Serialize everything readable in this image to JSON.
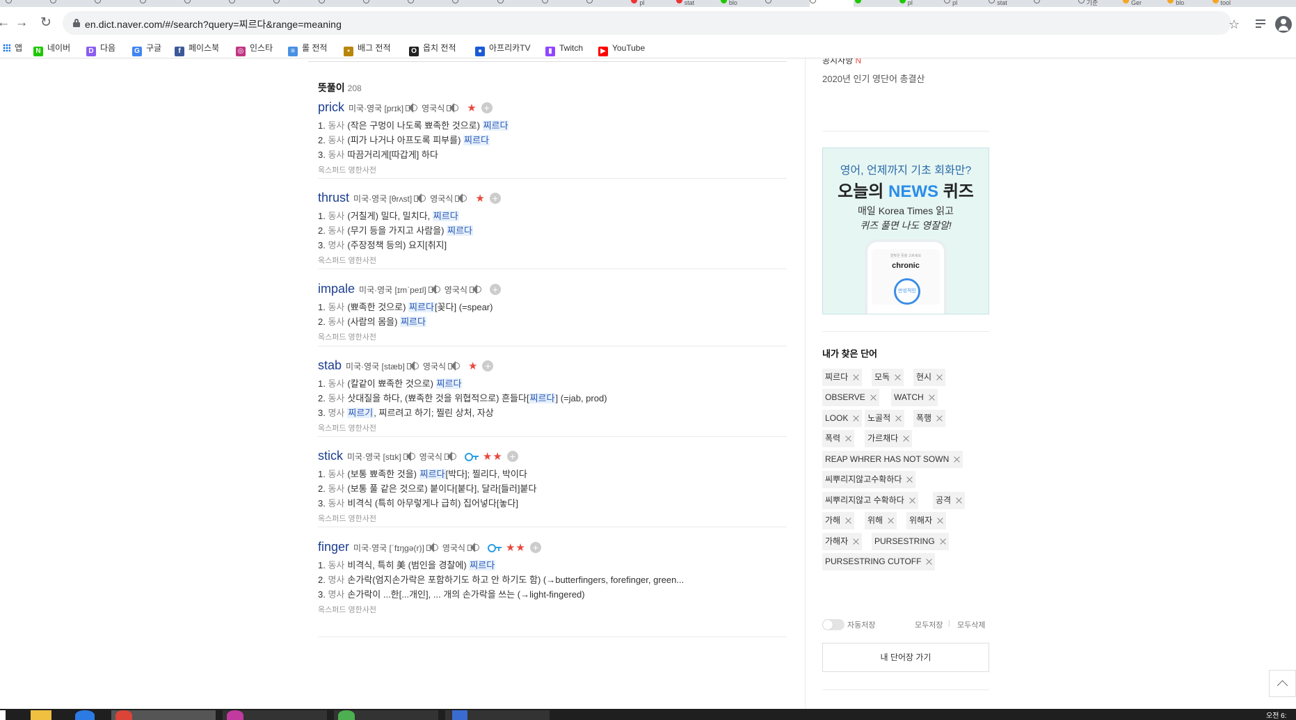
{
  "browser": {
    "url": "en.dict.naver.com/#/search?query=찌르다&range=meaning",
    "tabs": [
      "",
      "",
      "",
      "",
      "",
      "",
      "",
      "",
      "",
      "",
      "",
      "",
      "",
      "",
      "pl",
      "stat",
      "blo",
      "",
      "",
      "",
      "pl",
      "pl",
      "stat",
      "",
      "기준",
      "Ger",
      "blo",
      "tool"
    ]
  },
  "bookmarks": [
    {
      "label": "앱",
      "icon": "apps-grid-icon",
      "color": "#1a73e8"
    },
    {
      "label": "네이버",
      "icon": "naver-n-icon",
      "color": "#1ec800"
    },
    {
      "label": "다음",
      "icon": "daum-d-icon",
      "color": "#8a5cf0"
    },
    {
      "label": "구글",
      "icon": "google-g-icon",
      "color": "#4285f4"
    },
    {
      "label": "페이스북",
      "icon": "facebook-f-icon",
      "color": "#3b5998"
    },
    {
      "label": "인스타",
      "icon": "instagram-icon",
      "color": "#c13584"
    },
    {
      "label": "롤 전적",
      "icon": "opgg-icon",
      "color": "#4a90e2"
    },
    {
      "label": "배그 전적",
      "icon": "pubg-icon",
      "color": "#b8860b"
    },
    {
      "label": "옵치 전적",
      "icon": "overbuff-icon",
      "color": "#222222"
    },
    {
      "label": "아프리카TV",
      "icon": "afreecatv-icon",
      "color": "#1c5bd6"
    },
    {
      "label": "Twitch",
      "icon": "twitch-icon",
      "color": "#9146ff"
    },
    {
      "label": "YouTube",
      "icon": "youtube-icon",
      "color": "#ff0000"
    }
  ],
  "results": {
    "section_title": "뜻풀이",
    "count": "208",
    "entries": [
      {
        "word": "prick",
        "pron_us": "미국·영국 [prɪk]",
        "pron_uk": "영국식",
        "stars": "★",
        "key": false,
        "meanings": [
          {
            "num": "1.",
            "pos": "동사",
            "pre": "(작은 구멍이 나도록 뾰족한 것으로) ",
            "hl": "찌르다",
            "post": ""
          },
          {
            "num": "2.",
            "pos": "동사",
            "pre": "(피가 나거나 아프도록 피부를) ",
            "hl": "찌르다",
            "post": ""
          },
          {
            "num": "3.",
            "pos": "동사",
            "pre": "따끔거리게[따갑게] 하다",
            "hl": "",
            "post": ""
          }
        ],
        "source": "옥스퍼드 영한사전"
      },
      {
        "word": "thrust",
        "pron_us": "미국·영국 [θrʌst]",
        "pron_uk": "영국식",
        "stars": "★",
        "key": false,
        "meanings": [
          {
            "num": "1.",
            "pos": "동사",
            "pre": "(거칠게) 밀다, 밀치다, ",
            "hl": "찌르다",
            "post": ""
          },
          {
            "num": "2.",
            "pos": "동사",
            "pre": "(무기 등을 가지고 사람을) ",
            "hl": "찌르다",
            "post": ""
          },
          {
            "num": "3.",
            "pos": "명사",
            "pre": "(주장정책 등의) 요지[취지]",
            "hl": "",
            "post": ""
          }
        ],
        "source": "옥스퍼드 영한사전"
      },
      {
        "word": "impale",
        "pron_us": "미국·영국 [ɪmˈpeɪl]",
        "pron_uk": "영국식",
        "stars": "",
        "key": false,
        "meanings": [
          {
            "num": "1.",
            "pos": "동사",
            "pre": "(뾰족한 것으로) ",
            "hl": "찌르다",
            "post": "[꽂다] (=spear)"
          },
          {
            "num": "2.",
            "pos": "동사",
            "pre": "(사람의 몸을) ",
            "hl": "찌르다",
            "post": ""
          }
        ],
        "source": "옥스퍼드 영한사전"
      },
      {
        "word": "stab",
        "pron_us": "미국·영국 [stæb]",
        "pron_uk": "영국식",
        "stars": "★",
        "key": false,
        "meanings": [
          {
            "num": "1.",
            "pos": "동사",
            "pre": "(칼같이 뾰족한 것으로) ",
            "hl": "찌르다",
            "post": ""
          },
          {
            "num": "2.",
            "pos": "동사",
            "pre": "삿대질을 하다, (뾰족한 것을 위협적으로) 흔들다[",
            "hl": "찌르다",
            "post": "] (=jab, prod)"
          },
          {
            "num": "3.",
            "pos": "명사",
            "pre": "",
            "hl": "찌르기",
            "post": ", 찌르려고 하기; 찔린 상처, 자상"
          }
        ],
        "source": "옥스퍼드 영한사전"
      },
      {
        "word": "stick",
        "pron_us": "미국·영국 [stɪk]",
        "pron_uk": "영국식",
        "stars": "★★",
        "key": true,
        "meanings": [
          {
            "num": "1.",
            "pos": "동사",
            "pre": "(보통 뾰족한 것을) ",
            "hl": "찌르다",
            "post": "[박다]; 찔리다, 박이다"
          },
          {
            "num": "2.",
            "pos": "동사",
            "pre": "(보통 풀 같은 것으로) 붙이다[붙다], 달라[들러]붙다",
            "hl": "",
            "post": ""
          },
          {
            "num": "3.",
            "pos": "동사",
            "pre": "비격식 (특히 아무렇게나 급히) 집어넣다[놓다]",
            "hl": "",
            "post": ""
          }
        ],
        "source": "옥스퍼드 영한사전"
      },
      {
        "word": "finger",
        "pron_us": "미국·영국 [ˈfɪŋɡə(r)]",
        "pron_uk": "영국식",
        "stars": "★★",
        "key": true,
        "meanings": [
          {
            "num": "1.",
            "pos": "동사",
            "pre": "비격식, 특히 美 (범인을 경찰에) ",
            "hl": "찌르다",
            "post": ""
          },
          {
            "num": "2.",
            "pos": "명사",
            "pre": "손가락(엄지손가락은 포함하기도 하고 안 하기도 함) (→butterfingers, forefinger, green...",
            "hl": "",
            "post": ""
          },
          {
            "num": "3.",
            "pos": "명사",
            "pre": "손가락이 ...한[...개인], ... 개의 손가락을 쓰는 (→light-fingered)",
            "hl": "",
            "post": ""
          }
        ],
        "source": "옥스퍼드 영한사전"
      }
    ]
  },
  "sidebar": {
    "cut_heading": "공지사항",
    "cut_mark": "N",
    "popular_link": "2020년 인기 영단어 총결산",
    "ad": {
      "line1": "영어, 언제까지 기초 회화만?",
      "line2a": "오늘의 ",
      "line2b": "NEWS",
      "line2c": " 퀴즈",
      "line3": "매일 Korea Times 읽고",
      "line4": "퀴즈 풀면 나도 영잘알!",
      "phone_sub": "알맞은 뜻을 고르세요",
      "phone_word": "chronic",
      "phone_btn": "만성적인"
    },
    "my_words_title": "내가 찾은 단어",
    "chips": [
      "찌르다",
      "모독",
      "현시",
      "OBSERVE",
      "WATCH",
      "LOOK",
      "노골적",
      "폭행",
      "폭력",
      "가르채다",
      "REAP WHRER HAS NOT SOWN",
      "씨뿌리지않고수확하다",
      "씨뿌리지않고 수확하다",
      "공격",
      "가해",
      "위해",
      "위해자",
      "가해자",
      "PURSESTRING",
      "PURSESTRING CUTOFF"
    ],
    "autosave": "자동저장",
    "save_all": "모두저장",
    "delete_all": "모두삭제",
    "wordbook_btn": "내 단어장 가기"
  },
  "taskbar": {
    "clock": "오전 6:"
  }
}
